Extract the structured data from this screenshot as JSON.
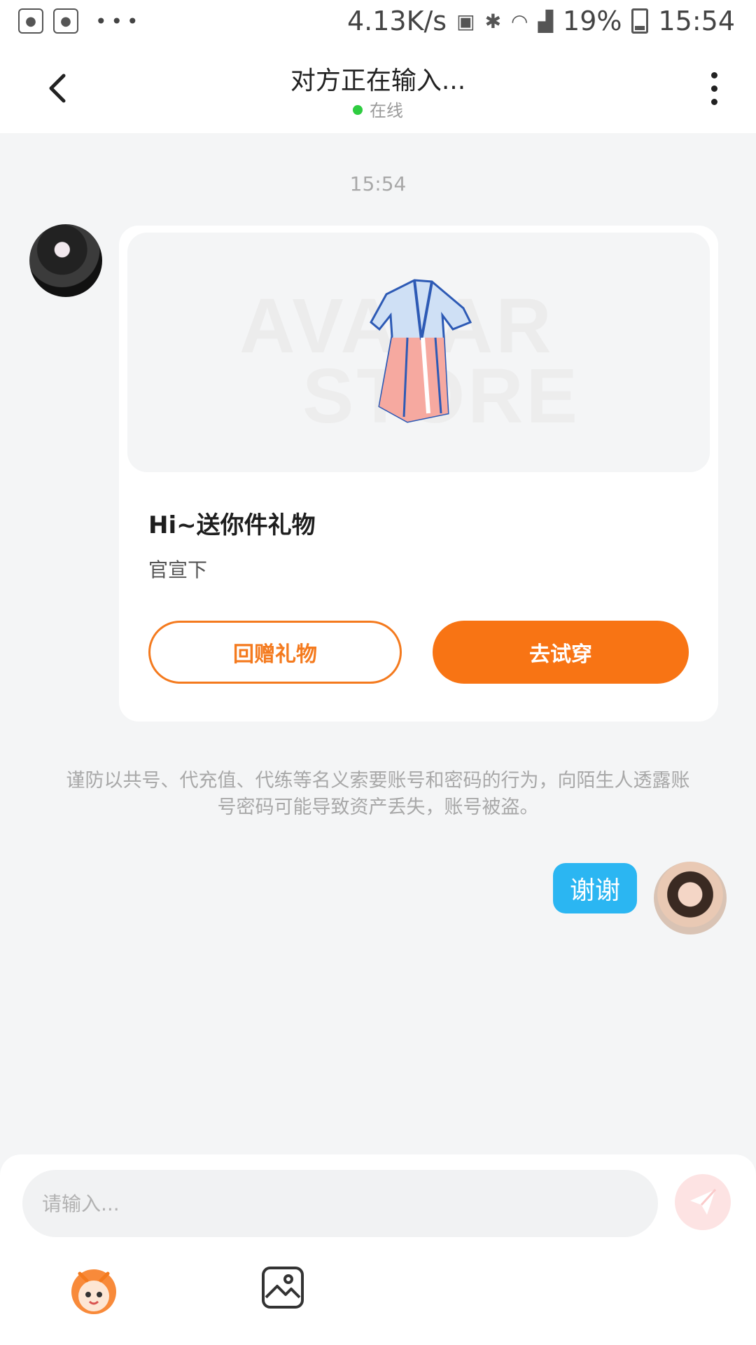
{
  "status_bar": {
    "speed": "4.13K/s",
    "battery": "19%",
    "time": "15:54",
    "icons": [
      "baidu-icon",
      "baidu-icon",
      "more-dots",
      "battery-saver-icon",
      "bluetooth-icon",
      "wifi-icon",
      "signal-icon",
      "battery-icon"
    ]
  },
  "header": {
    "title": "对方正在输入...",
    "status": "在线",
    "status_color": "#2ecc40"
  },
  "chat": {
    "timestamp": "15:54",
    "gift": {
      "watermark_line1": "AVATAR",
      "watermark_line2": "STORE",
      "title": "Hi~送你件礼物",
      "subtitle": "官宣下",
      "return_gift": "回赠礼物",
      "try_on": "去试穿",
      "accent": "#f87414"
    },
    "warning": "谨防以共号、代充值、代练等名义索要账号和密码的行为，向陌生人透露账号密码可能导致资产丢失，账号被盗。",
    "self_message": "谢谢",
    "self_bubble_color": "#2bb6f2"
  },
  "input": {
    "placeholder": "请输入..."
  }
}
